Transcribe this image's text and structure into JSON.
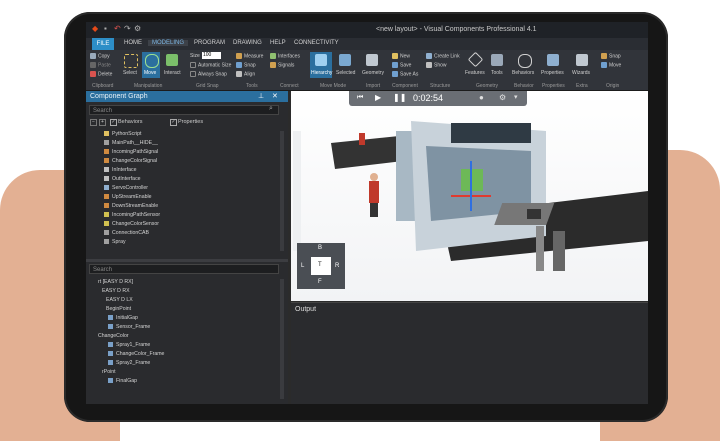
{
  "app": {
    "title": "<new layout> - Visual Components Professional 4.1"
  },
  "menu": {
    "file": "FILE",
    "items": [
      "HOME",
      "MODELING",
      "PROGRAM",
      "DRAWING",
      "HELP",
      "CONNECTIVITY"
    ]
  },
  "ribbon": {
    "clipboard": {
      "copy": "Copy",
      "paste": "Paste",
      "delete": "Delete",
      "label": "Clipboard"
    },
    "select": "Select",
    "move": "Move",
    "interact": "Interact",
    "manipulation": "Manipulation",
    "grid": {
      "size": "Size",
      "size_value": "100",
      "auto_size": "Automatic Size",
      "always_snap": "Always Snap",
      "label": "Grid Snap"
    },
    "tools": {
      "measure": "Measure",
      "snap": "Snap",
      "align": "Align",
      "label": "Tools"
    },
    "connect": {
      "interfaces": "Interfaces",
      "signals": "Signals",
      "label": "Connect"
    },
    "hierarchy": "Hierarchy",
    "selected": "Selected",
    "move_mode": "Move Mode",
    "geometry": "Geometry",
    "import": "Import",
    "component": {
      "new": "New",
      "save": "Save",
      "save_as": "Save As",
      "label": "Component"
    },
    "structure": {
      "create_link": "Create Link",
      "show": "Show",
      "label": "Structure"
    },
    "features": "Features",
    "tools2": "Tools",
    "geometry2": "Geometry",
    "behaviors": "Behaviors",
    "behavior_label": "Behavior",
    "properties": "Properties",
    "properties_label": "Properties",
    "wizards": "Wizards",
    "extra": "Extra",
    "origin": {
      "snap": "Snap",
      "move": "Move",
      "label": "Origin"
    }
  },
  "component_graph": {
    "title": "Component Graph",
    "search_placeholder": "Search",
    "behaviors": "Behaviors",
    "properties": "Properties",
    "tree_items": [
      "PythonScript",
      "MainPath__HIDE__",
      "IncomingPathSignal",
      "ChangeColorSignal",
      "InInterface",
      "OutInterface",
      "ServoController",
      "UpStreamEnable",
      "DownStreamEnable",
      "IncomingPathSensor",
      "ChangeColorSensor",
      "ConnectionCAB",
      "Spray"
    ]
  },
  "lower_panel": {
    "search_placeholder": "Search",
    "tree_items": [
      "rt [EASY D RX]",
      "EASY D RX",
      "EASY D LX",
      "BeginPoint",
      "InitialGap",
      "Sensor_Frame",
      "ChangeColor",
      "Spray1_Frame",
      "ChangeColor_Frame",
      "Spray2_Frame",
      "rPoint",
      "FinalGap"
    ]
  },
  "viewport": {
    "time": "0:02:54",
    "cube": {
      "top": "B",
      "left": "L",
      "center": "T",
      "right": "R",
      "bottom": "F"
    }
  },
  "output": {
    "title": "Output"
  }
}
